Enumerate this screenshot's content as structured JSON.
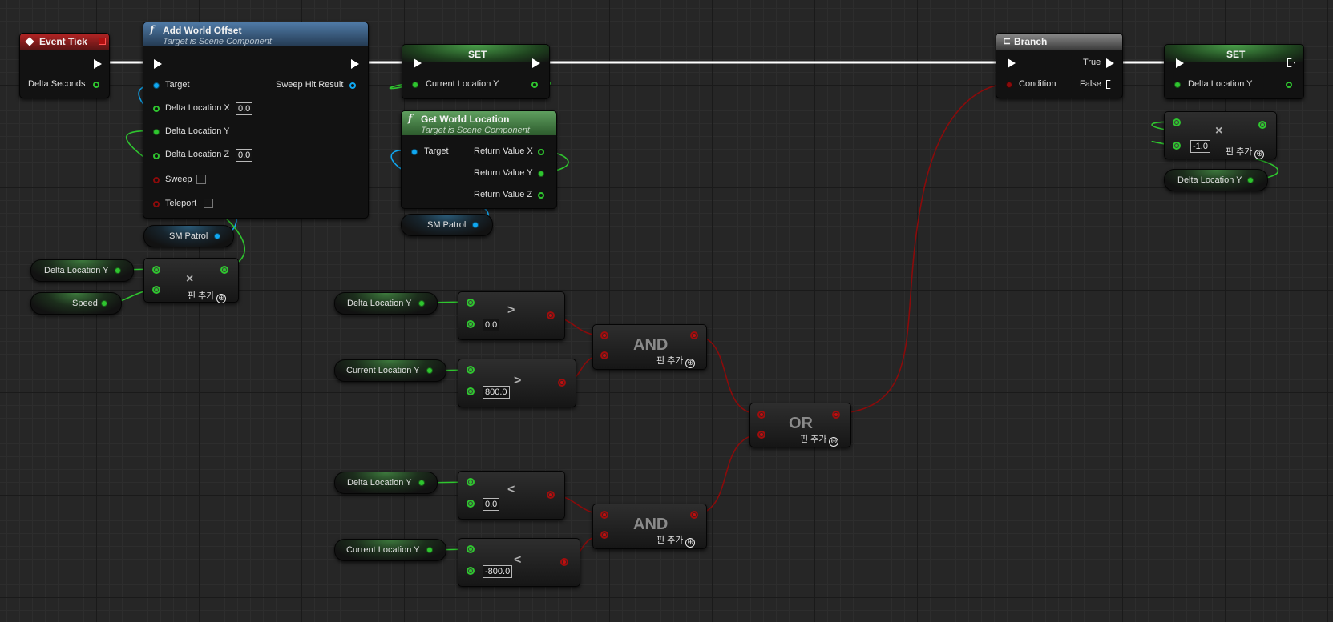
{
  "event_tick": {
    "title": "Event Tick",
    "delta_seconds": "Delta Seconds"
  },
  "add_world_offset": {
    "fn_symbol": "f",
    "title": "Add World Offset",
    "subtitle": "Target is Scene Component",
    "target": "Target",
    "sweep_hit_result": "Sweep Hit Result",
    "delta_x": "Delta Location X",
    "delta_x_value": "0.0",
    "delta_y": "Delta Location Y",
    "delta_z": "Delta Location Z",
    "delta_z_value": "0.0",
    "sweep": "Sweep",
    "teleport": "Teleport"
  },
  "set1": {
    "title": "SET",
    "pin": "Current Location Y"
  },
  "get_world_location": {
    "fn_symbol": "f",
    "title": "Get World Location",
    "subtitle": "Target is Scene Component",
    "target": "Target",
    "ret_x": "Return Value X",
    "ret_y": "Return Value Y",
    "ret_z": "Return Value Z"
  },
  "branch": {
    "title": "Branch",
    "condition": "Condition",
    "true_label": "True",
    "false_label": "False"
  },
  "set2": {
    "title": "SET",
    "pin": "Delta Location Y"
  },
  "variables": {
    "sm_patrol": "SM Patrol",
    "delta_location_y": "Delta Location Y",
    "speed": "Speed",
    "current_location_y": "Current Location Y"
  },
  "ops": {
    "multiply": "×",
    "greater": ">",
    "less": "<",
    "and": "AND",
    "or": "OR",
    "add_pin": "핀 추가",
    "add_pin_icon": "⊕"
  },
  "values": {
    "neg_one": "-1.0",
    "zero_a": "0.0",
    "eight_hundred": "800.0",
    "zero_b": "0.0",
    "neg_eight_hundred": "-800.0"
  },
  "colors": {
    "exec": "#ffffff",
    "float": "#2fc52f",
    "object": "#10a8f2",
    "boolean": "#8a0b0b",
    "event_header": "#b32424",
    "function_header": "#4f7aa6",
    "pure_header": "#5f9f5f"
  }
}
